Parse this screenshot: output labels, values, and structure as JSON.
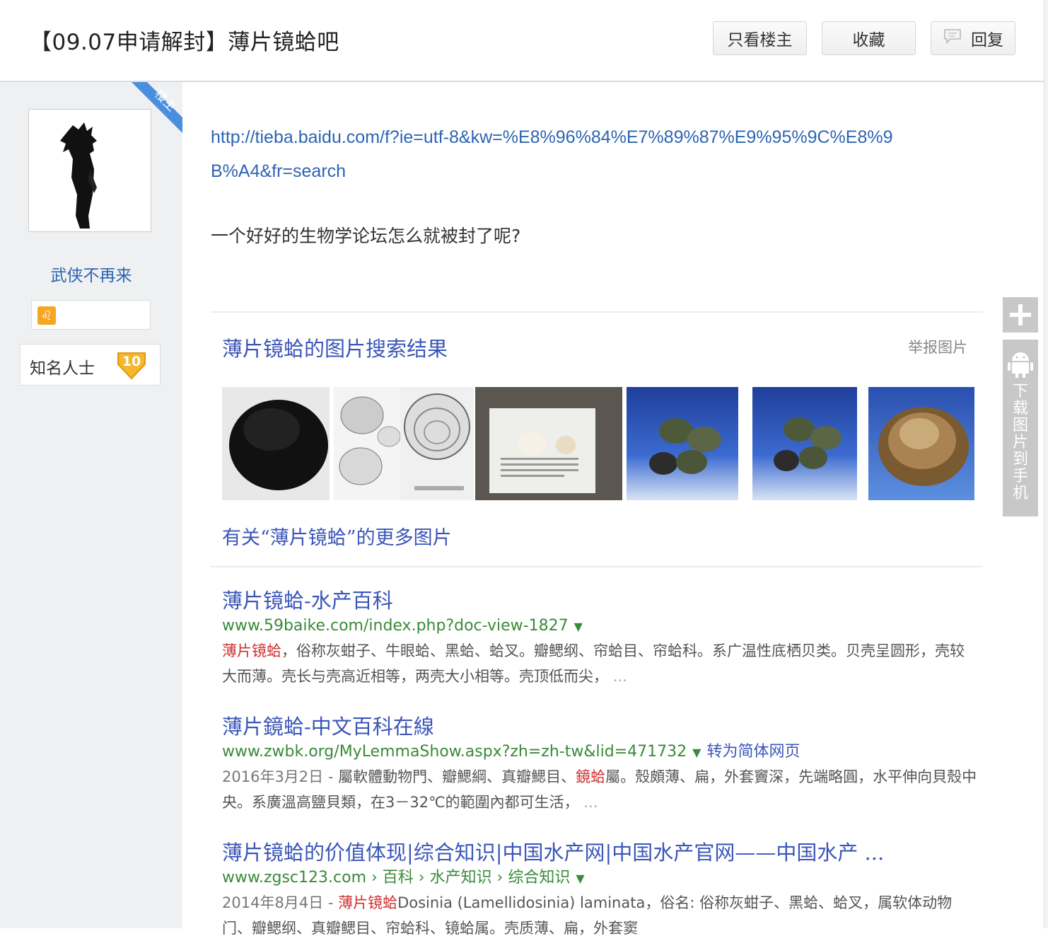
{
  "header": {
    "title": "【09.07申请解封】薄片镜蛤吧",
    "btn_only_op": "只看楼主",
    "btn_favorite": "收藏",
    "btn_reply": "回复"
  },
  "author": {
    "op_corner_badge": "楼主",
    "name": "武侠不再来",
    "rank_title": "知名人士",
    "rank_level": "10"
  },
  "post": {
    "link": "http://tieba.baidu.com/f?ie=utf-8&kw=%E8%96%84%E7%89%87%E9%95%9C%E8%9B%A4&fr=search",
    "text": "一个好好的生物学论坛怎么就被封了呢?"
  },
  "image_search": {
    "title": "薄片镜蛤的图片搜索结果",
    "report": "举报图片",
    "more": "有关“薄片镜蛤”的更多图片"
  },
  "results": [
    {
      "title": "薄片镜蛤-水产百科",
      "url": "www.59baike.com/index.php?doc-view-1827",
      "snippet_hl": "薄片镜蛤",
      "snippet": "，俗称灰蚶子、牛眼蛤、黑蛤、蛤叉。瓣鳃纲、帘蛤目、帘蛤科。系广温性底栖贝类。贝壳呈圆形，壳较大而薄。壳长与壳高近相等，两壳大小相等。壳顶低而尖，",
      "ellipsis": "..."
    },
    {
      "title": "薄片鏡蛤-中文百科在線",
      "url": "www.zwbk.org/MyLemmaShow.aspx?zh=zh-tw&lid=471732",
      "translate": "转为简体网页",
      "date": "2016年3月2日 - ",
      "snippet_pre": "屬軟體動物門、瓣鰓綱、真瓣鰓目、",
      "snippet_hl": "鏡蛤",
      "snippet": "屬。殼頗薄、扁，外套竇深，先端略圓，水平伸向貝殼中央。系廣溫高鹽貝類，在3－32℃的範圍內都可生活，",
      "ellipsis": "..."
    },
    {
      "title": "薄片镜蛤的价值体现|综合知识|中国水产网|中国水产官网——中国水产 ...",
      "url": "www.zgsc123.com › 百科 › 水产知识 › 综合知识",
      "date": "2014年8月4日 - ",
      "snippet_hl": "薄片镜蛤",
      "snippet": "Dosinia (Lamellidosinia) laminata，俗名: 俗称灰蚶子、黑蛤、蛤叉，属软体动物门、瓣鳃纲、真瓣鳃目、帘蛤科、镜蛤属。壳质薄、扁，外套窦"
    }
  ],
  "side": {
    "download": "下载图片到手机"
  }
}
